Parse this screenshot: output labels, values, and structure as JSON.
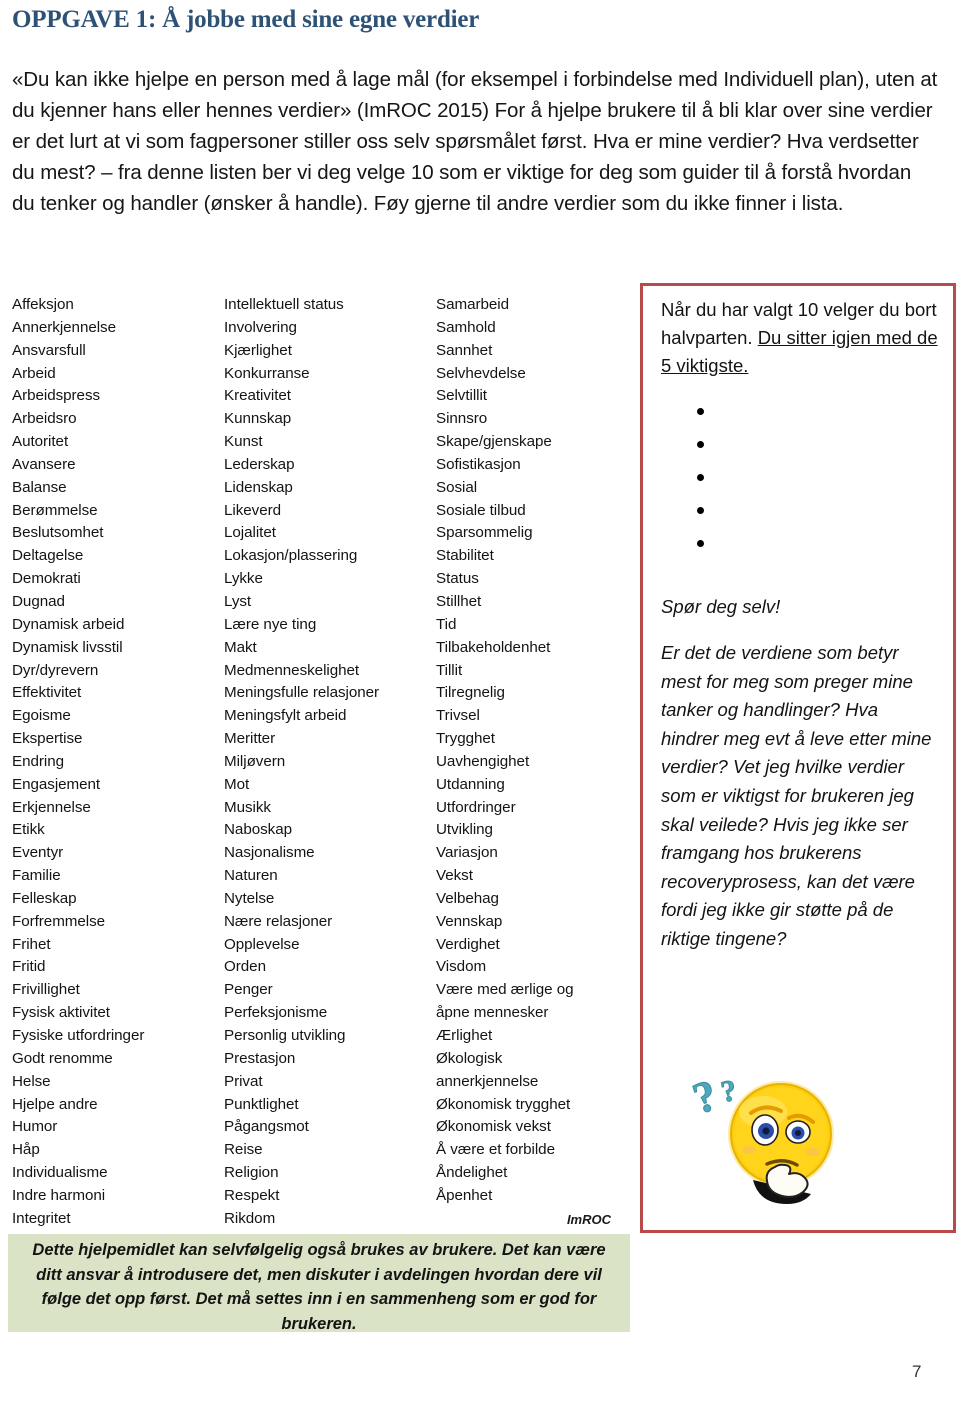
{
  "document": {
    "title": "OPPGAVE 1: Å jobbe med sine egne verdier",
    "title_color": "#2e5276",
    "page_number": "7",
    "intro_paragraph": "«Du kan ikke hjelpe en person med å lage mål (for eksempel i forbindelse med Individuell plan), uten at du kjenner hans eller hennes verdier» (ImROC 2015) For å hjelpe brukere til å bli klar over sine verdier er det lurt at vi som fagpersoner stiller oss selv spørsmålet først. Hva er mine verdier? Hva verdsetter du mest? – fra denne listen ber vi deg velge 10 som er viktige for deg som guider til å forstå hvordan du tenker og handler (ønsker å handle). Føy gjerne til andre verdier som du ikke finner i lista.",
    "credit": "ImROC"
  },
  "values_list": {
    "column_1": [
      "Affeksjon",
      "Annerkjennelse",
      "Ansvarsfull",
      "Arbeid",
      "Arbeidspress",
      "Arbeidsro",
      "Autoritet",
      "Avansere",
      "Balanse",
      "Berømmelse",
      "Beslutsomhet",
      "Deltagelse",
      "Demokrati",
      "Dugnad",
      "Dynamisk arbeid",
      "Dynamisk livsstil",
      "Dyr/dyrevern",
      "Effektivitet",
      "Egoisme",
      "Ekspertise",
      "Endring",
      "Engasjement",
      "Erkjennelse",
      "Etikk",
      "Eventyr",
      "Familie",
      "Felleskap",
      "Forfremmelse",
      "Frihet",
      "Fritid",
      "Frivillighet",
      "Fysisk aktivitet",
      "Fysiske utfordringer",
      "Godt renomme",
      "Helse",
      "Hjelpe andre",
      "Humor",
      "Håp",
      "Individualisme",
      "Indre harmoni",
      "Integritet"
    ],
    "column_2": [
      "Intellektuell status",
      "Involvering",
      "Kjærlighet",
      "Konkurranse",
      "Kreativitet",
      "Kunnskap",
      "Kunst",
      "Lederskap",
      "Lidenskap",
      "Likeverd",
      "Lojalitet",
      "Lokasjon/plassering",
      "Lykke",
      "Lyst",
      "Lære nye ting",
      "Makt",
      "Medmenneskelighet",
      "Meningsfulle relasjoner",
      "Meningsfylt arbeid",
      "Meritter",
      "Miljøvern",
      "Mot",
      "Musikk",
      "Naboskap",
      "Nasjonalisme",
      "Naturen",
      "Nytelse",
      "Nære relasjoner",
      "Opplevelse",
      "Orden",
      "Penger",
      "Perfeksjonisme",
      "Personlig utvikling",
      "Prestasjon",
      "Privat",
      "Punktlighet",
      "Pågangsmot",
      "Reise",
      "Religion",
      "Respekt",
      "Rikdom"
    ],
    "column_3": [
      "Samarbeid",
      "Samhold",
      "Sannhet",
      "Selvhevdelse",
      "Selvtillit",
      "Sinnsro",
      "Skape/gjenskape",
      "Sofistikasjon",
      "Sosial",
      "Sosiale tilbud",
      "Sparsommelig",
      "Stabilitet",
      "Status",
      "Stillhet",
      "Tid",
      "Tilbakeholdenhet",
      "Tillit",
      "Tilregnelig",
      "Trivsel",
      "Trygghet",
      "Uavhengighet",
      "Utdanning",
      "Utfordringer",
      "Utvikling",
      "Variasjon",
      "Vekst",
      "Velbehag",
      "Vennskap",
      "Verdighet",
      "Visdom",
      "Være med ærlige og",
      "åpne mennesker",
      "Ærlighet",
      "Økologisk",
      "annerkjennelse",
      "Økonomisk trygghet",
      "Økonomisk vekst",
      "Å være et forbilde",
      "Åndelighet",
      "Åpenhet"
    ]
  },
  "sidebar": {
    "border_color": "#b84a4a",
    "intro_plain": "Når du har valgt 10 velger du bort halvparten. ",
    "intro_underlined": "Du sitter igjen med de 5 viktigste.",
    "bullets": [
      "",
      "",
      "",
      "",
      ""
    ],
    "ask_heading": "Spør deg selv!",
    "questions": "Er det de verdiene som betyr mest for meg som preger mine tanker og handlinger? Hva hindrer meg evt å leve etter mine verdier? Vet jeg hvilke verdier som er viktigst for brukeren jeg skal veilede? Hvis jeg ikke ser framgang hos brukerens recoveryprosess, kan det være fordi jeg ikke gir støtte på de riktige tingene?",
    "emoji_name": "thinking-face-emoji"
  },
  "footer_note": {
    "background_color": "#dbe3c6",
    "text": "Dette hjelpemidlet kan selvfølgelig også brukes av brukere. Det kan være ditt ansvar å introdusere det, men diskuter i avdelingen hvordan dere vil følge det opp først. Det må settes inn i en sammenheng som er god for brukeren."
  }
}
